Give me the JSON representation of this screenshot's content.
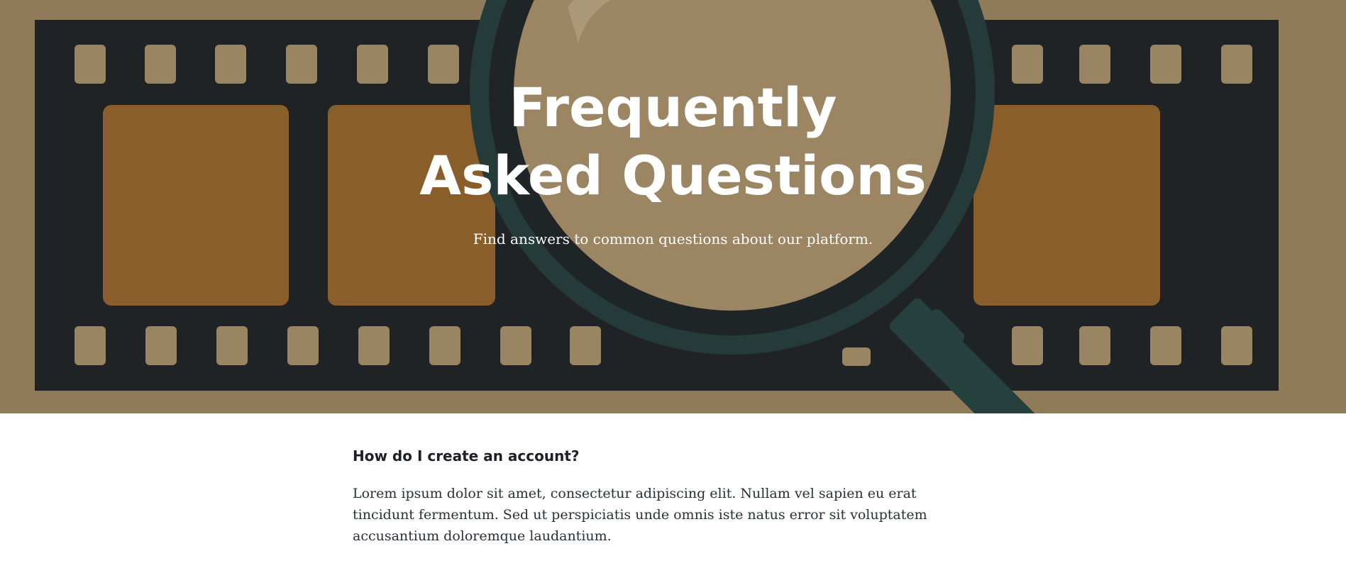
{
  "hero": {
    "title_line1": "Frequently",
    "title_line2": "Asked Questions",
    "subtitle": "Find answers to common questions about our platform."
  },
  "faq": {
    "items": [
      {
        "question": "How do I create an account?",
        "answer": "Lorem ipsum dolor sit amet, consectetur adipiscing elit. Nullam vel sapien eu erat tincidunt fermentum. Sed ut perspiciatis unde omnis iste natus error sit voluptatem accusantium doloremque laudantium."
      }
    ]
  },
  "colors": {
    "hero_background": "#8f7a5a",
    "film_strip": "#202325",
    "film_frame": "#8a5e2a",
    "magnifier_ring": "#253b3a",
    "text_dark": "#1d2127"
  },
  "icons": {
    "hero_illustration": "film-strip-with-magnifying-glass-icon"
  }
}
